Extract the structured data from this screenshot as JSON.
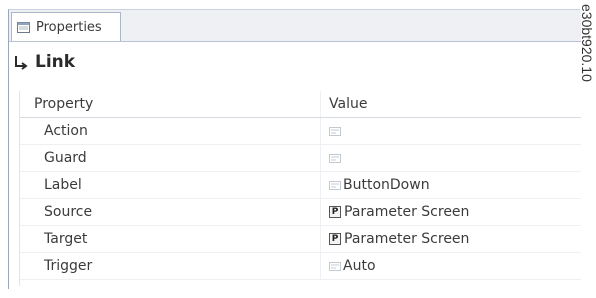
{
  "tab": {
    "label": "Properties",
    "icon": "properties-window-icon"
  },
  "header": {
    "title": "Link",
    "icon": "link-arrow-icon"
  },
  "grid": {
    "columns": [
      "Property",
      "Value"
    ],
    "rows": [
      {
        "property": "Action",
        "value": "",
        "value_icon": "text-value-icon"
      },
      {
        "property": "Guard",
        "value": "",
        "value_icon": "text-value-icon"
      },
      {
        "property": "Label",
        "value": "ButtonDown",
        "value_icon": "text-value-icon"
      },
      {
        "property": "Source",
        "value": "Parameter Screen",
        "value_icon": "parameter-screen-icon",
        "icon_letter": "P"
      },
      {
        "property": "Target",
        "value": "Parameter Screen",
        "value_icon": "parameter-screen-icon",
        "icon_letter": "P"
      },
      {
        "property": "Trigger",
        "value": "Auto",
        "value_icon": "text-value-icon"
      }
    ]
  },
  "watermark": "e30bt920.10"
}
